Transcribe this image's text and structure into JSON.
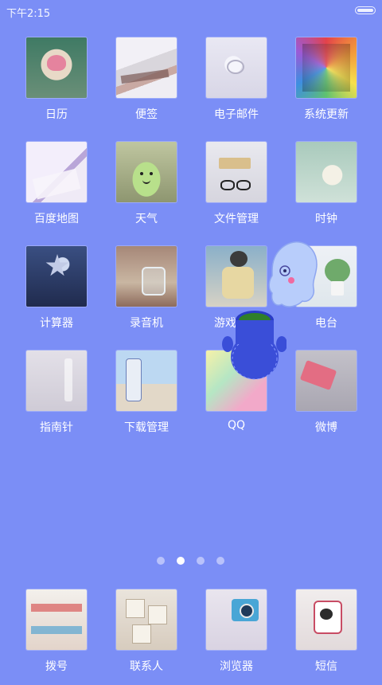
{
  "status_bar": {
    "time": "下午2:15"
  },
  "apps": [
    {
      "label": "日历"
    },
    {
      "label": "便签"
    },
    {
      "label": "电子邮件"
    },
    {
      "label": "系统更新"
    },
    {
      "label": "百度地图"
    },
    {
      "label": "天气"
    },
    {
      "label": "文件管理"
    },
    {
      "label": "时钟"
    },
    {
      "label": "计算器"
    },
    {
      "label": "录音机"
    },
    {
      "label": "游戏中心"
    },
    {
      "label": "电台"
    },
    {
      "label": "指南针"
    },
    {
      "label": "下载管理"
    },
    {
      "label": "QQ"
    },
    {
      "label": "微博"
    }
  ],
  "dock": [
    {
      "label": "拨号"
    },
    {
      "label": "联系人"
    },
    {
      "label": "浏览器"
    },
    {
      "label": "短信"
    }
  ],
  "pager": {
    "page_count": 4,
    "current_page": 2
  },
  "colors": {
    "wallpaper": "#7b8ef6",
    "active_dot": "#ffffff",
    "inactive_dot": "#b9c2fb"
  }
}
